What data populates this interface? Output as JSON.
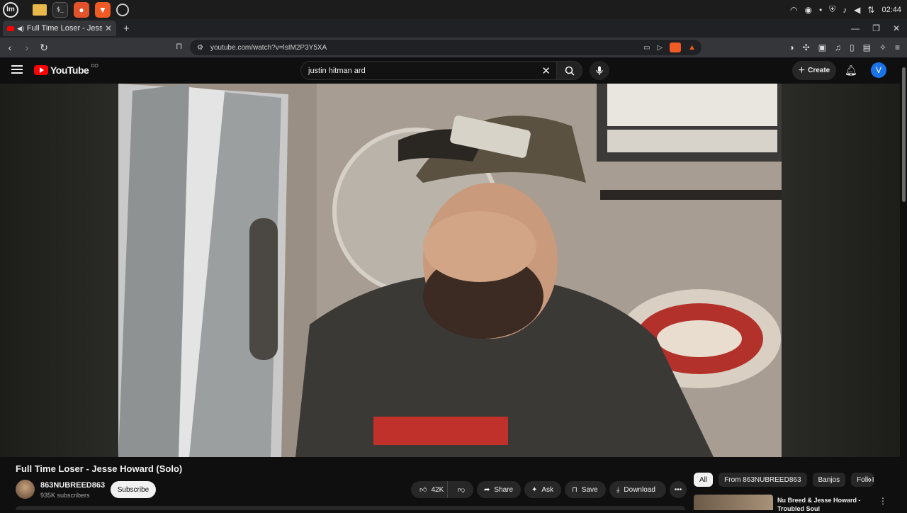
{
  "taskbar": {
    "apps": [
      "mint-menu",
      "files",
      "terminal",
      "firefox",
      "brave",
      "chromium"
    ],
    "clock": "02:44"
  },
  "browser": {
    "tab_title": "Full Time Loser - Jesse Ho",
    "url": "youtube.com/watch?v=lsIM2P3Y5XA"
  },
  "youtube": {
    "logo_text": "YouTube",
    "logo_region": "DO",
    "search_query": "justin hitman ard",
    "create_label": "Create",
    "avatar_letter": "V"
  },
  "video": {
    "title": "Full Time Loser - Jesse Howard (Solo)",
    "channel_name": "863NUBREED863",
    "subscribers": "935K subscribers",
    "subscribe_label": "Subscribe",
    "like_count": "42K",
    "share_label": "Share",
    "ask_label": "Ask",
    "save_label": "Save",
    "download_label": "Download"
  },
  "sidebar": {
    "chips": [
      "All",
      "From 863NUBREED863",
      "Banjos",
      "Folk I"
    ],
    "rec_title": "Nu Breed & Jesse Howard - Troubled Soul"
  }
}
